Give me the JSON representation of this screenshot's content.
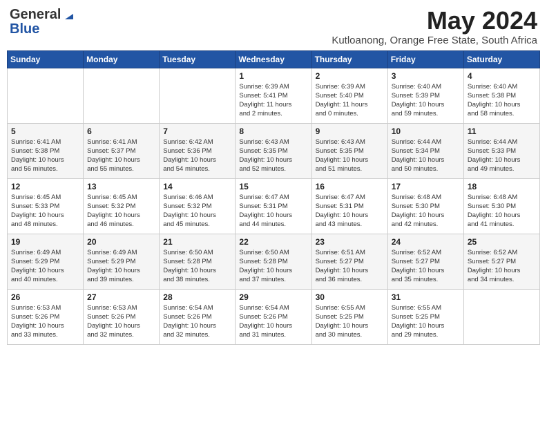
{
  "logo": {
    "general": "General",
    "blue": "Blue"
  },
  "title": {
    "month": "May 2024",
    "location": "Kutloanong, Orange Free State, South Africa"
  },
  "weekdays": [
    "Sunday",
    "Monday",
    "Tuesday",
    "Wednesday",
    "Thursday",
    "Friday",
    "Saturday"
  ],
  "weeks": [
    [
      {
        "day": "",
        "info": ""
      },
      {
        "day": "",
        "info": ""
      },
      {
        "day": "",
        "info": ""
      },
      {
        "day": "1",
        "info": "Sunrise: 6:39 AM\nSunset: 5:41 PM\nDaylight: 11 hours\nand 2 minutes."
      },
      {
        "day": "2",
        "info": "Sunrise: 6:39 AM\nSunset: 5:40 PM\nDaylight: 11 hours\nand 0 minutes."
      },
      {
        "day": "3",
        "info": "Sunrise: 6:40 AM\nSunset: 5:39 PM\nDaylight: 10 hours\nand 59 minutes."
      },
      {
        "day": "4",
        "info": "Sunrise: 6:40 AM\nSunset: 5:38 PM\nDaylight: 10 hours\nand 58 minutes."
      }
    ],
    [
      {
        "day": "5",
        "info": "Sunrise: 6:41 AM\nSunset: 5:38 PM\nDaylight: 10 hours\nand 56 minutes."
      },
      {
        "day": "6",
        "info": "Sunrise: 6:41 AM\nSunset: 5:37 PM\nDaylight: 10 hours\nand 55 minutes."
      },
      {
        "day": "7",
        "info": "Sunrise: 6:42 AM\nSunset: 5:36 PM\nDaylight: 10 hours\nand 54 minutes."
      },
      {
        "day": "8",
        "info": "Sunrise: 6:43 AM\nSunset: 5:35 PM\nDaylight: 10 hours\nand 52 minutes."
      },
      {
        "day": "9",
        "info": "Sunrise: 6:43 AM\nSunset: 5:35 PM\nDaylight: 10 hours\nand 51 minutes."
      },
      {
        "day": "10",
        "info": "Sunrise: 6:44 AM\nSunset: 5:34 PM\nDaylight: 10 hours\nand 50 minutes."
      },
      {
        "day": "11",
        "info": "Sunrise: 6:44 AM\nSunset: 5:33 PM\nDaylight: 10 hours\nand 49 minutes."
      }
    ],
    [
      {
        "day": "12",
        "info": "Sunrise: 6:45 AM\nSunset: 5:33 PM\nDaylight: 10 hours\nand 48 minutes."
      },
      {
        "day": "13",
        "info": "Sunrise: 6:45 AM\nSunset: 5:32 PM\nDaylight: 10 hours\nand 46 minutes."
      },
      {
        "day": "14",
        "info": "Sunrise: 6:46 AM\nSunset: 5:32 PM\nDaylight: 10 hours\nand 45 minutes."
      },
      {
        "day": "15",
        "info": "Sunrise: 6:47 AM\nSunset: 5:31 PM\nDaylight: 10 hours\nand 44 minutes."
      },
      {
        "day": "16",
        "info": "Sunrise: 6:47 AM\nSunset: 5:31 PM\nDaylight: 10 hours\nand 43 minutes."
      },
      {
        "day": "17",
        "info": "Sunrise: 6:48 AM\nSunset: 5:30 PM\nDaylight: 10 hours\nand 42 minutes."
      },
      {
        "day": "18",
        "info": "Sunrise: 6:48 AM\nSunset: 5:30 PM\nDaylight: 10 hours\nand 41 minutes."
      }
    ],
    [
      {
        "day": "19",
        "info": "Sunrise: 6:49 AM\nSunset: 5:29 PM\nDaylight: 10 hours\nand 40 minutes."
      },
      {
        "day": "20",
        "info": "Sunrise: 6:49 AM\nSunset: 5:29 PM\nDaylight: 10 hours\nand 39 minutes."
      },
      {
        "day": "21",
        "info": "Sunrise: 6:50 AM\nSunset: 5:28 PM\nDaylight: 10 hours\nand 38 minutes."
      },
      {
        "day": "22",
        "info": "Sunrise: 6:50 AM\nSunset: 5:28 PM\nDaylight: 10 hours\nand 37 minutes."
      },
      {
        "day": "23",
        "info": "Sunrise: 6:51 AM\nSunset: 5:27 PM\nDaylight: 10 hours\nand 36 minutes."
      },
      {
        "day": "24",
        "info": "Sunrise: 6:52 AM\nSunset: 5:27 PM\nDaylight: 10 hours\nand 35 minutes."
      },
      {
        "day": "25",
        "info": "Sunrise: 6:52 AM\nSunset: 5:27 PM\nDaylight: 10 hours\nand 34 minutes."
      }
    ],
    [
      {
        "day": "26",
        "info": "Sunrise: 6:53 AM\nSunset: 5:26 PM\nDaylight: 10 hours\nand 33 minutes."
      },
      {
        "day": "27",
        "info": "Sunrise: 6:53 AM\nSunset: 5:26 PM\nDaylight: 10 hours\nand 32 minutes."
      },
      {
        "day": "28",
        "info": "Sunrise: 6:54 AM\nSunset: 5:26 PM\nDaylight: 10 hours\nand 32 minutes."
      },
      {
        "day": "29",
        "info": "Sunrise: 6:54 AM\nSunset: 5:26 PM\nDaylight: 10 hours\nand 31 minutes."
      },
      {
        "day": "30",
        "info": "Sunrise: 6:55 AM\nSunset: 5:25 PM\nDaylight: 10 hours\nand 30 minutes."
      },
      {
        "day": "31",
        "info": "Sunrise: 6:55 AM\nSunset: 5:25 PM\nDaylight: 10 hours\nand 29 minutes."
      },
      {
        "day": "",
        "info": ""
      }
    ]
  ]
}
